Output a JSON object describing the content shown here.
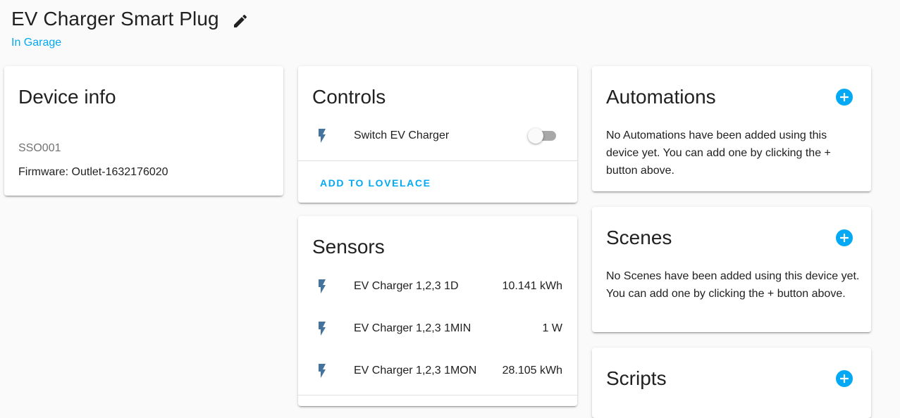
{
  "header": {
    "device_name": "EV Charger Smart Plug",
    "area": "In Garage"
  },
  "device_info": {
    "title": "Device info",
    "model": "SSO001",
    "firmware": "Firmware: Outlet-1632176020"
  },
  "controls": {
    "title": "Controls",
    "entities": [
      {
        "name": "Switch EV Charger",
        "icon": "flash-icon",
        "state": "off"
      }
    ],
    "action_label": "ADD TO LOVELACE"
  },
  "sensors": {
    "title": "Sensors",
    "entities": [
      {
        "name": "EV Charger 1,2,3 1D",
        "state": "10.141 kWh",
        "icon": "flash-icon"
      },
      {
        "name": "EV Charger 1,2,3 1MIN",
        "state": "1 W",
        "icon": "flash-icon"
      },
      {
        "name": "EV Charger 1,2,3 1MON",
        "state": "28.105 kWh",
        "icon": "flash-icon"
      }
    ]
  },
  "automations": {
    "title": "Automations",
    "text": "No Automations have been added using this device yet. You can add one by clicking the + button above."
  },
  "scenes": {
    "title": "Scenes",
    "text": "No Scenes have been added using this device yet. You can add one by clicking the + button above."
  },
  "scripts": {
    "title": "Scripts"
  },
  "colors": {
    "accent": "#03a9f4",
    "icon": "#44739e",
    "background": "#fafafa"
  }
}
